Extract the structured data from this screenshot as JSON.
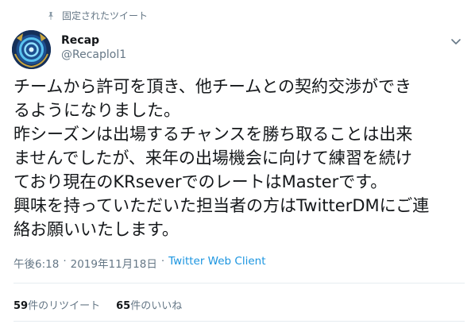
{
  "pinned_label": "固定されたツイート",
  "author": {
    "name": "Recap",
    "handle": "@Recaplol1"
  },
  "tweet_lines": [
    "チームから許可を頂き、他チームとの契約交渉ができ",
    "るようになりました。",
    "昨シーズンは出場するチャンスを勝ち取ることは出来",
    "ませんでしたが、来年の出場機会に向けて練習を続け",
    "ており現在のKRseverでのレートはMasterです。",
    "興味を持っていただいた担当者の方はTwitterDMにご連",
    "絡お願いいたします。"
  ],
  "meta": {
    "time": "午後6:18",
    "separator": "·",
    "date": "2019年11月18日",
    "client": "Twitter Web Client"
  },
  "stats": {
    "retweets_count": "59",
    "retweets_label": "件のリツイート",
    "likes_count": "65",
    "likes_label": "件のいいね"
  },
  "colors": {
    "accent": "#1b95e0",
    "muted": "#657786",
    "text": "#14171a",
    "divider": "#e6ecf0"
  },
  "icons": {
    "pin": "pin-icon",
    "caret": "chevron-down-icon"
  }
}
